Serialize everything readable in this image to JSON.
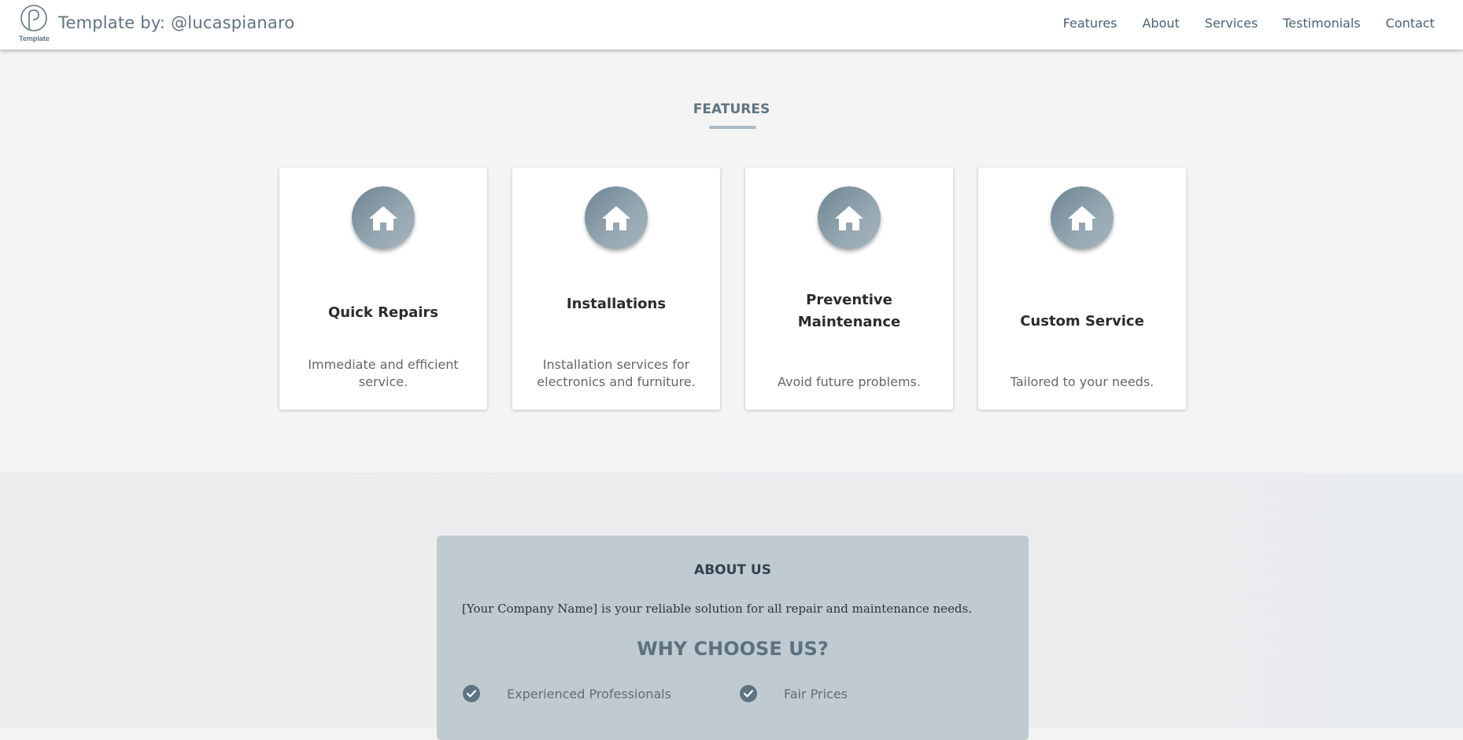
{
  "header": {
    "logo_label": "Template",
    "brand": "Template by: @lucaspianaro",
    "nav": [
      "Features",
      "About",
      "Services",
      "Testimonials",
      "Contact"
    ]
  },
  "features": {
    "title": "FEATURES",
    "icon": "house-icon",
    "cards": [
      {
        "title": "Quick Repairs",
        "description": "Immediate and efficient service."
      },
      {
        "title": "Installations",
        "description": "Installation services for electronics and furniture."
      },
      {
        "title": "Preventive Maintenance",
        "description": "Avoid future problems."
      },
      {
        "title": "Custom Service",
        "description": "Tailored to your needs."
      }
    ]
  },
  "about": {
    "title": "ABOUT US",
    "text": "[Your Company Name] is your reliable solution for all repair and maintenance needs.",
    "why_title": "WHY CHOOSE US?",
    "items": [
      "Experienced Professionals",
      "Fair Prices"
    ]
  },
  "colors": {
    "accent": "#5f7482",
    "about_box": "#bfcad1",
    "page_bg": "#f4f4f4"
  }
}
